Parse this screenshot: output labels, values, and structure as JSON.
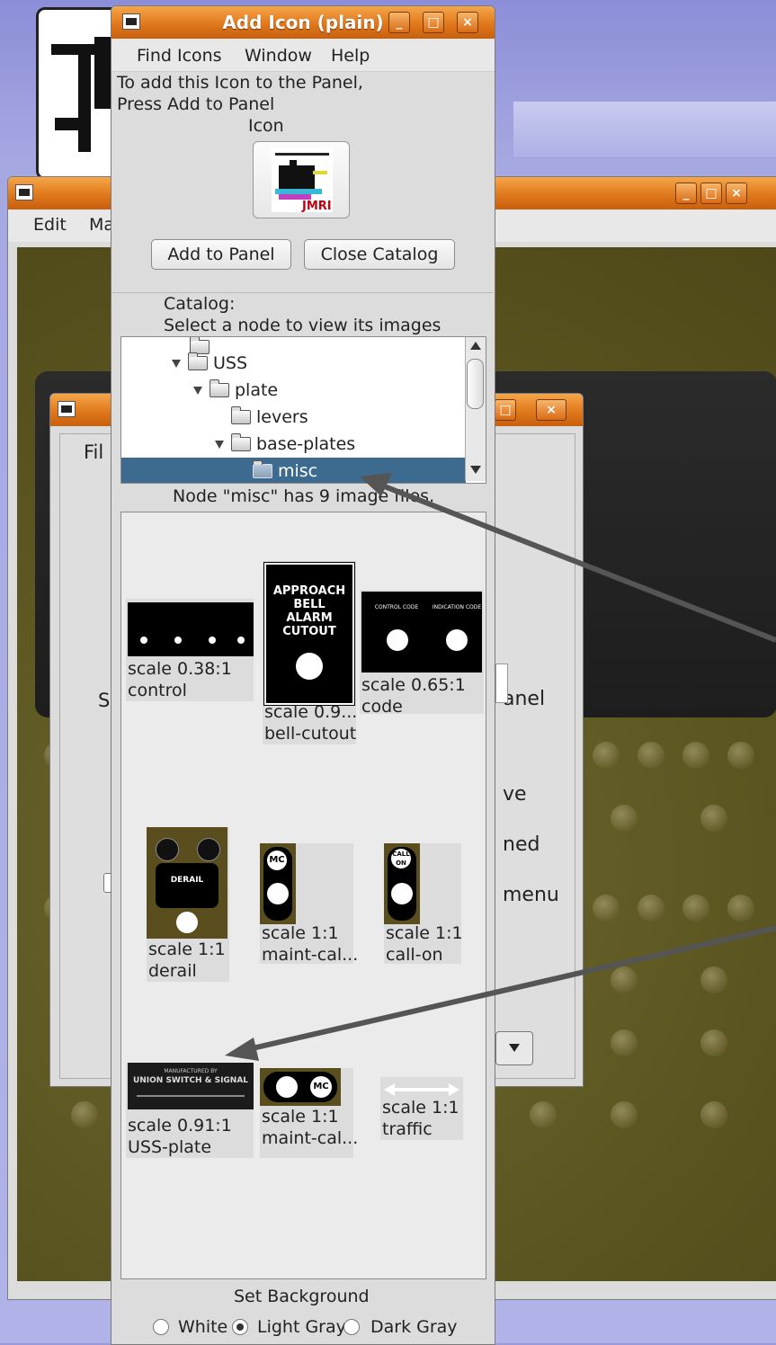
{
  "add_icon_window": {
    "title": "Add Icon (plain)",
    "menu": [
      "Find Icons",
      "Window",
      "Help"
    ],
    "instructions_line1": "To add this Icon to the Panel,",
    "instructions_line2": "Press Add to Panel",
    "icon_label": "Icon",
    "preview_icon": "jmri-logo-icon",
    "add_button": "Add to Panel",
    "close_button": "Close Catalog",
    "catalog_label": "Catalog:",
    "catalog_hint": "Select a node to view its images",
    "tree": [
      {
        "label": "USS",
        "depth": 0,
        "expanded": true
      },
      {
        "label": "plate",
        "depth": 1,
        "expanded": true
      },
      {
        "label": "levers",
        "depth": 2,
        "expanded": false
      },
      {
        "label": "base-plates",
        "depth": 2,
        "expanded": true
      },
      {
        "label": "misc",
        "depth": 3,
        "selected": true
      }
    ],
    "node_status": "Node \"misc\" has 9 image files.",
    "images": [
      {
        "scale": "scale 0.38:1",
        "name": "control"
      },
      {
        "scale": "scale 0.9...",
        "name": "bell-cutout",
        "plate_text": [
          "APPROACH",
          "BELL",
          "ALARM",
          "CUTOUT"
        ]
      },
      {
        "scale": "scale 0.65:1",
        "name": "code",
        "plate_text": [
          "CONTROL CODE",
          "INDICATION CODE"
        ]
      },
      {
        "scale": "scale 1:1",
        "name": "derail",
        "plate_text": [
          "DERAIL"
        ]
      },
      {
        "scale": "scale 1:1",
        "name": "maint-cal...",
        "plate_text": [
          "MC"
        ]
      },
      {
        "scale": "scale 1:1",
        "name": "call-on",
        "plate_text": [
          "CALL ON"
        ]
      },
      {
        "scale": "scale 0.91:1",
        "name": "USS-plate",
        "plate_text": [
          "MANUFACTURED BY",
          "UNION SWITCH & SIGNAL"
        ]
      },
      {
        "scale": "scale 1:1",
        "name": "maint-cal...",
        "plate_text": [
          "MC"
        ]
      },
      {
        "scale": "scale 1:1",
        "name": "traffic"
      }
    ],
    "background_label": "Set Background",
    "background_options": [
      "White",
      "Light Gray",
      "Dark Gray"
    ],
    "background_selected": "Light Gray"
  },
  "editor_window": {
    "menu": [
      "Edit",
      "Ma"
    ]
  },
  "mid_dialog": {
    "menu_partial": "Fil",
    "partial_labels": [
      "S",
      "anel",
      "ve",
      "ned",
      "menu"
    ]
  },
  "colors": {
    "titlebar": "#e0781c",
    "selection": "#3d6b8f",
    "panel_olive": "#5a5420"
  }
}
